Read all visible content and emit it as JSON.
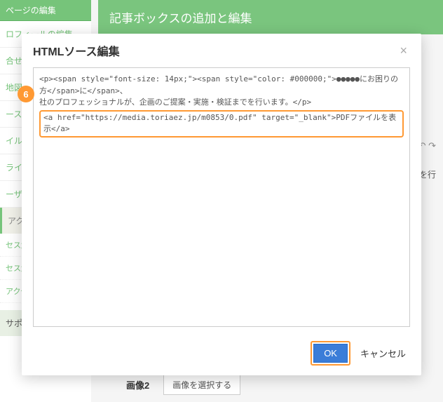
{
  "sidebar": {
    "header": "ページの編集",
    "items": [
      "ロフィールの編集",
      "合せフォー",
      "地図の",
      "ースペー",
      "イルアッ",
      "ライド画像",
      "ーザー情報"
    ],
    "access_section": "アクセ",
    "access_items": [
      "セス解析を",
      "セス解析の"
    ],
    "access_link": "アクセス解",
    "support": "サポートを利用"
  },
  "main": {
    "header": "記事ボックスの追加と編集",
    "toolbar_icons": "↶ ↷",
    "bg_text": "証までを行",
    "image_label": "画像2",
    "image_select": "画像を選択する"
  },
  "modal": {
    "title": "HTMLソース編集",
    "step_badge": "6",
    "source_line1": "<p><span style=\"font-size: 14px;\"><span style=\"color: #000000;\">●●●●●にお困りの方</span>に</span>、",
    "source_line2": "社のプロフェッショナルが、企画のご提案・実施・検証までを行います。</p>",
    "source_line3": "<a href=\"https://media.toriaez.jp/m0853/0.pdf\" target=\"_blank\">PDFファイルを表示</a>",
    "ok_label": "OK",
    "cancel_label": "キャンセル"
  }
}
